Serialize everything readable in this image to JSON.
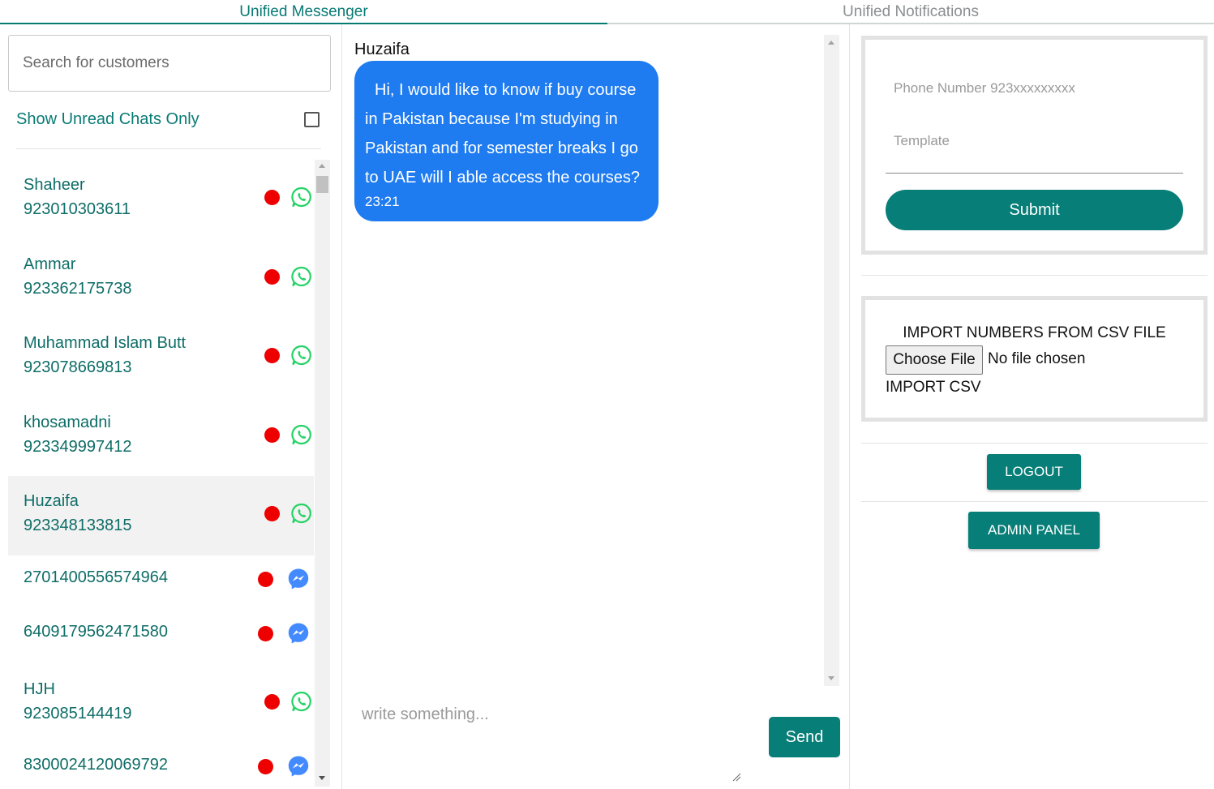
{
  "tabs": {
    "messenger": "Unified Messenger",
    "notifications": "Unified Notifications"
  },
  "colors": {
    "primary": "#077e77",
    "bubble": "#1e7bf0",
    "unread_dot": "#ee0000",
    "whatsapp": "#25d366",
    "messenger": "#448aff"
  },
  "sidebar": {
    "search_placeholder": "Search for customers",
    "unread_label": "Show Unread Chats Only",
    "unread_checked": false,
    "chats": [
      {
        "name": "Shaheer",
        "phone": "923010303611",
        "channel": "whatsapp-icon",
        "unread": true,
        "selected": false
      },
      {
        "name": "Ammar",
        "phone": "923362175738",
        "channel": "whatsapp-icon",
        "unread": true,
        "selected": false
      },
      {
        "name": "Muhammad Islam Butt",
        "phone": "923078669813",
        "channel": "whatsapp-icon",
        "unread": true,
        "selected": false
      },
      {
        "name": "khosamadni",
        "phone": "923349997412",
        "channel": "whatsapp-icon",
        "unread": true,
        "selected": false
      },
      {
        "name": "Huzaifa",
        "phone": "923348133815",
        "channel": "whatsapp-icon",
        "unread": true,
        "selected": true
      },
      {
        "name": "",
        "phone": "2701400556574964",
        "channel": "messenger-icon",
        "unread": true,
        "selected": false
      },
      {
        "name": "",
        "phone": "6409179562471580",
        "channel": "messenger-icon",
        "unread": true,
        "selected": false
      },
      {
        "name": "HJH",
        "phone": "923085144419",
        "channel": "whatsapp-icon",
        "unread": true,
        "selected": false
      },
      {
        "name": "",
        "phone": "8300024120069792",
        "channel": "messenger-icon",
        "unread": true,
        "selected": false
      }
    ]
  },
  "conversation": {
    "title": "Huzaifa",
    "messages": [
      {
        "text": "Hi, I would like to know if buy course in Pakistan because I'm studying in Pakistan and for semester breaks I go to UAE will I able access the courses?",
        "time": "23:21"
      }
    ],
    "compose_placeholder": "write something...",
    "send_label": "Send"
  },
  "notifications": {
    "phone_placeholder": "Phone Number 923xxxxxxxxx",
    "template_placeholder": "Template",
    "submit_label": "Submit",
    "import_title": "IMPORT NUMBERS FROM CSV FILE",
    "choose_file_label": "Choose File",
    "no_file_label": "No file chosen",
    "import_csv_label": "IMPORT CSV",
    "logout_label": "LOGOUT",
    "admin_label": "ADMIN PANEL"
  }
}
